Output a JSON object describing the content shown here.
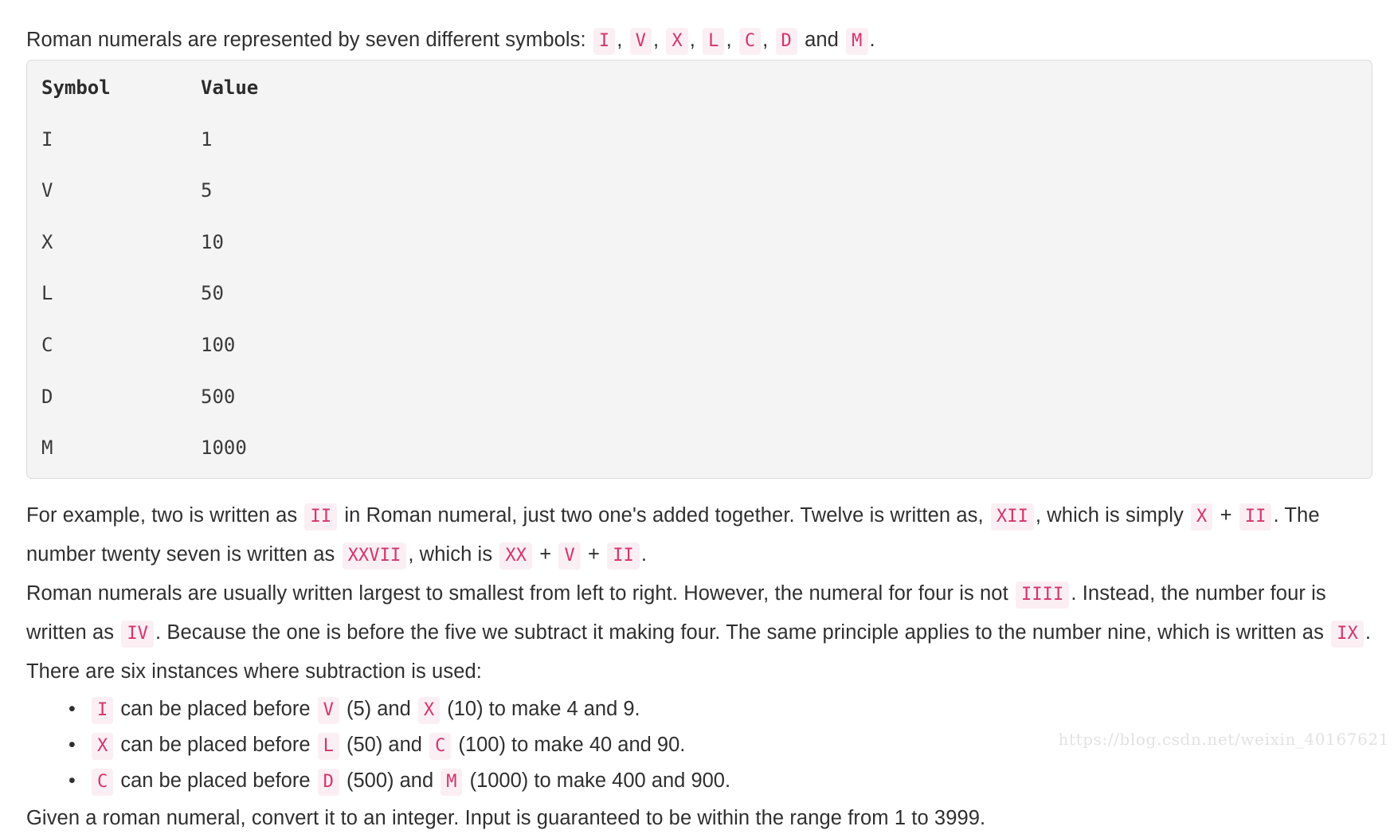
{
  "intro": {
    "lead": "Roman numerals are represented by seven different symbols:",
    "symbols": [
      "I",
      "V",
      "X",
      "L",
      "C",
      "D",
      "M"
    ],
    "comma": ",",
    "and_word": "and",
    "period": "."
  },
  "code_block": {
    "columns": [
      "Symbol",
      "Value"
    ],
    "rows": [
      {
        "symbol": "I",
        "value": "1"
      },
      {
        "symbol": "V",
        "value": "5"
      },
      {
        "symbol": "X",
        "value": "10"
      },
      {
        "symbol": "L",
        "value": "50"
      },
      {
        "symbol": "C",
        "value": "100"
      },
      {
        "symbol": "D",
        "value": "500"
      },
      {
        "symbol": "M",
        "value": "1000"
      }
    ]
  },
  "example_paragraph": {
    "t1": "For example, two is written as",
    "c1": "II",
    "t2": "in Roman numeral, just two one's added together. Twelve is written as,",
    "c2": "XII",
    "t3": ", which is simply",
    "c3": "X",
    "t4": "+",
    "c4": "II",
    "t5": ". The number twenty seven is written as",
    "c5": "XXVII",
    "t6": ", which is",
    "c6": "XX",
    "t7": "+",
    "c7": "V",
    "t8": "+",
    "c8": "II",
    "t9": "."
  },
  "rules_paragraph": {
    "t1": "Roman numerals are usually written largest to smallest from left to right. However, the numeral for four is not",
    "c1": "IIII",
    "t2": ". Instead, the number four is written as",
    "c2": "IV",
    "t3": ". Because the one is before the five we subtract it making four. The same principle applies to the number nine, which is written as",
    "c3": "IX",
    "t4": ". There are six instances where subtraction is used:"
  },
  "subtraction_rules": [
    {
      "numeral": "I",
      "mid": "can be placed before",
      "first": "V",
      "first_value": "(5)",
      "and_word": "and",
      "second": "X",
      "second_value": "(10)",
      "tail": "to make 4 and 9."
    },
    {
      "numeral": "X",
      "mid": "can be placed before",
      "first": "L",
      "first_value": "(50)",
      "and_word": "and",
      "second": "C",
      "second_value": "(100)",
      "tail": "to make 40 and 90."
    },
    {
      "numeral": "C",
      "mid": "can be placed before",
      "first": "D",
      "first_value": "(500)",
      "and_word": "and",
      "second": "M",
      "second_value": "(1000)",
      "tail": "to make 400 and 900."
    }
  ],
  "final_paragraph": {
    "text": "Given a roman numeral, convert it to an integer. Input is guaranteed to be within the range from 1 to 3999."
  },
  "watermark": {
    "text": "https://blog.csdn.net/weixin_40167621"
  },
  "colors": {
    "inline_code_text": "#d6336c",
    "inline_code_bg": "#fbeff3",
    "code_block_bg": "#f4f4f4",
    "code_block_border": "#dcdcdc",
    "body_text": "#2f2f2f",
    "watermark": "#e2e2e2"
  }
}
